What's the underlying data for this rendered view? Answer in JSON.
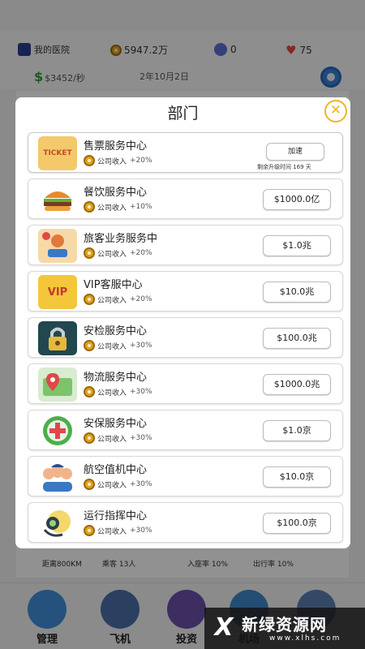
{
  "status": {
    "hospital_name": "我的医院",
    "coins": "5947.2万",
    "gems": "0",
    "hearts": "75",
    "income_rate": "$3452/秒",
    "date": "2年10月2日"
  },
  "background_stats": {
    "distance_label": "距离800KM",
    "passengers_label": "乘客 13人",
    "load_rate_label": "入座率 10%",
    "departure_rate_label": "出行率 10%"
  },
  "modal": {
    "title": "部门",
    "close_icon": "close-icon",
    "departments": [
      {
        "name": "售票服务中心",
        "income_label": "公司收入",
        "bonus": "+20%",
        "action": "加速",
        "remaining": "剩余升级时间 169 天",
        "icon": "ticket-icon"
      },
      {
        "name": "餐饮服务中心",
        "income_label": "公司收入",
        "bonus": "+10%",
        "price": "$1000.0亿",
        "icon": "burger-icon"
      },
      {
        "name": "旅客业务服务中",
        "income_label": "公司收入",
        "bonus": "+20%",
        "price": "$1.0兆",
        "icon": "service-desk-icon"
      },
      {
        "name": "VIP客服中心",
        "income_label": "公司收入",
        "bonus": "+20%",
        "price": "$10.0兆",
        "icon": "vip-crown-icon"
      },
      {
        "name": "安检服务中心",
        "income_label": "公司收入",
        "bonus": "+30%",
        "price": "$100.0兆",
        "icon": "lock-icon"
      },
      {
        "name": "物流服务中心",
        "income_label": "公司收入",
        "bonus": "+30%",
        "price": "$1000.0兆",
        "icon": "map-pin-icon"
      },
      {
        "name": "安保服务中心",
        "income_label": "公司收入",
        "bonus": "+30%",
        "price": "$1.0京",
        "icon": "medical-cross-icon"
      },
      {
        "name": "航空值机中心",
        "income_label": "公司收入",
        "bonus": "+30%",
        "price": "$10.0京",
        "icon": "crew-icon"
      },
      {
        "name": "运行指挥中心",
        "income_label": "公司收入",
        "bonus": "+30%",
        "price": "$100.0京",
        "icon": "headset-icon"
      }
    ]
  },
  "nav": {
    "items": [
      {
        "label": "管理",
        "icon": "globe-icon"
      },
      {
        "label": "飞机",
        "icon": "airplane-icon"
      },
      {
        "label": "投资",
        "icon": "investment-icon"
      },
      {
        "label": "机场",
        "icon": "airport-icon"
      },
      {
        "label": "",
        "icon": "more-icon"
      }
    ]
  },
  "watermark": {
    "logo": "Ⅹ",
    "title": "新绿资源网",
    "url": "www.xlhs.com"
  },
  "colors": {
    "accent_blue": "#3a7fd5",
    "coin_gold": "#e0a21f",
    "close_yellow": "#f0b429",
    "money_green": "#2e9b35",
    "heart_red": "#e04848"
  }
}
